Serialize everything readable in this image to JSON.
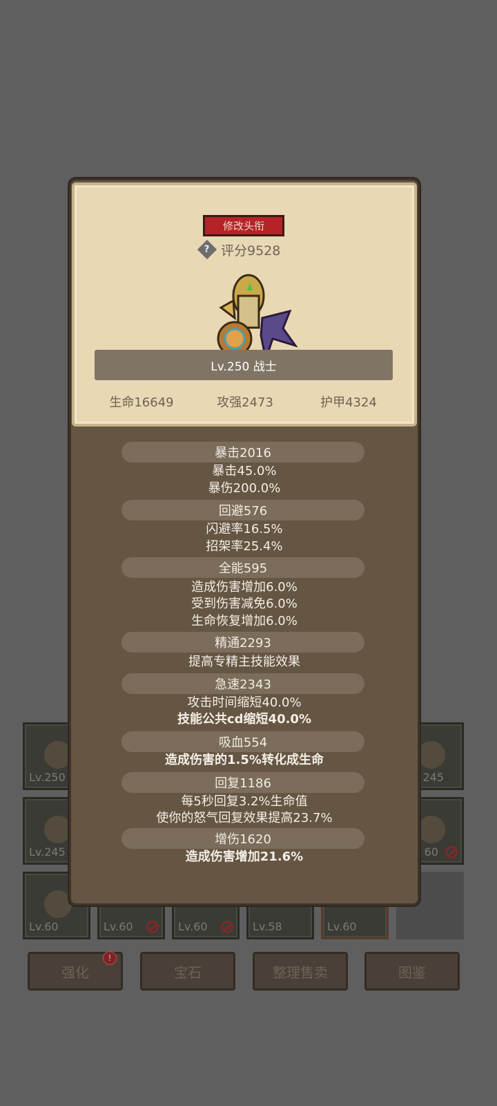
{
  "profile": {
    "change_title_label": "修改头衔",
    "score_label": "评分9528",
    "level_class": "Lv.250 战士",
    "stats": [
      "生命16649",
      "攻强2473",
      "护甲4324"
    ]
  },
  "attributes": [
    {
      "header": "暴击2016",
      "lines": [
        "暴击45.0%",
        "暴伤200.0%"
      ]
    },
    {
      "header": "回避576",
      "lines": [
        "闪避率16.5%",
        "招架率25.4%"
      ]
    },
    {
      "header": "全能595",
      "lines": [
        "造成伤害增加6.0%",
        "受到伤害减免6.0%",
        "生命恢复增加6.0%"
      ]
    },
    {
      "header": "精通2293",
      "lines": [
        "提高专精主技能效果"
      ]
    },
    {
      "header": "急速2343",
      "lines": [
        "攻击时间缩短40.0%",
        "技能公共cd缩短40.0%"
      ]
    },
    {
      "header": "吸血554",
      "lines": [
        "造成伤害的1.5%转化成生命"
      ]
    },
    {
      "header": "回复1186",
      "lines": [
        "每5秒回复3.2%生命值",
        "使你的怒气回复效果提高23.7%"
      ]
    },
    {
      "header": "增伤1620",
      "lines": [
        "造成伤害增加21.6%"
      ]
    }
  ],
  "inventory": {
    "slot_levels": [
      "Lv.250",
      "245",
      "Lv.245",
      "60",
      "Lv.60",
      "Lv.60",
      "Lv.60",
      "Lv.58",
      "Lv.60"
    ]
  },
  "bottom_buttons": [
    "强化",
    "宝石",
    "整理售卖",
    "图鉴"
  ],
  "badge": "!",
  "colors": {
    "title_button": "#b52227",
    "card_bg": "#e9d8b4",
    "panel_bg": "#655543"
  }
}
